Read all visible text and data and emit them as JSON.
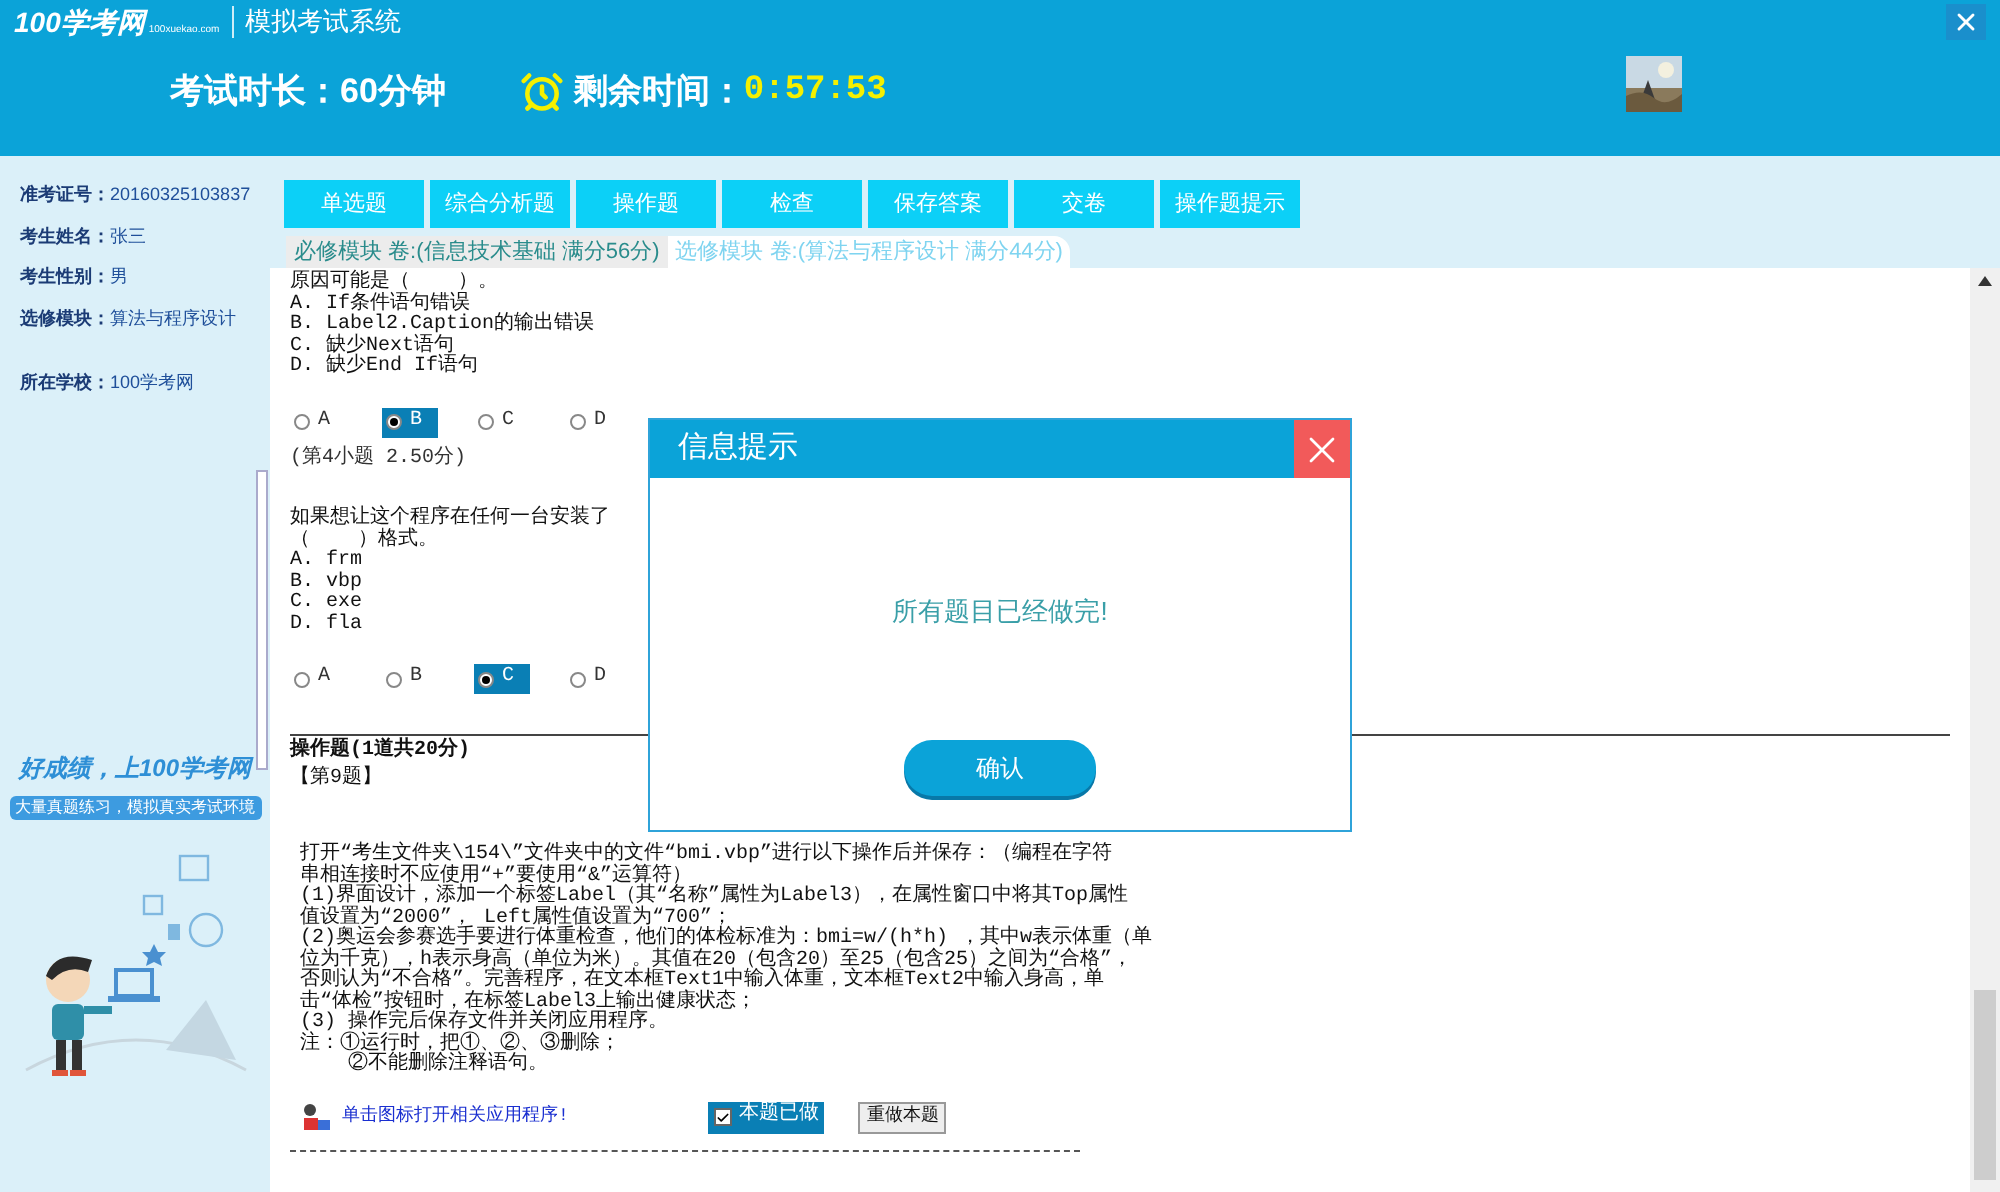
{
  "header": {
    "logo": "100学考网",
    "logo_url": "100xuekao.com",
    "app_title": "模拟考试系统",
    "duration": "考试时长：60分钟",
    "remaining_label": "剩余时间：",
    "remaining": "0:57:53"
  },
  "candidate": [
    {
      "label": "准考证号：",
      "value": "20160325103837"
    },
    {
      "label": "考生姓名：",
      "value": "张三"
    },
    {
      "label": "考生性别：",
      "value": "男"
    },
    {
      "label": "选修模块：",
      "value": "算法与程序设计"
    },
    {
      "label": "所在学校：",
      "value": "100学考网"
    }
  ],
  "promo": {
    "slogan": "好成绩，上100学考网",
    "tagline": "大量真题练习，模拟真实考试环境"
  },
  "toolbar": [
    "单选题",
    "综合分析题",
    "操作题",
    "检查",
    "保存答案",
    "交卷",
    "操作题提示"
  ],
  "tabs": [
    {
      "label": "必修模块 卷:(信息技术基础 满分56分)",
      "selected": true
    },
    {
      "label": "选修模块 卷:(算法与程序设计 满分44分)",
      "selected": false
    }
  ],
  "questions": [
    {
      "lines": [
        "原因可能是（    ）。",
        "A. If条件语句错误",
        "B. Label2.Caption的输出错误",
        "C. 缺少Next语句",
        "D. 缺少End If语句"
      ],
      "options": [
        {
          "label": "A",
          "selected": false
        },
        {
          "label": "B",
          "selected": true
        },
        {
          "label": "C",
          "selected": false
        },
        {
          "label": "D",
          "selected": false
        }
      ],
      "score": "(第4小题  2.50分)"
    },
    {
      "lines": [
        "如果想让这个程序在任何一台安装了",
        "（    ）格式。",
        "A. frm",
        "B. vbp",
        "C. exe",
        "D. fla"
      ],
      "options": [
        {
          "label": "A",
          "selected": false
        },
        {
          "label": "B",
          "selected": false
        },
        {
          "label": "C",
          "selected": true
        },
        {
          "label": "D",
          "selected": false
        }
      ]
    }
  ],
  "operation": {
    "heading": "操作题(1道共20分)",
    "number": "【第9题】",
    "lines": [
      "打开“考生文件夹\\154\\”文件夹中的文件“bmi.vbp”进行以下操作后并保存：（编程在字符",
      "串相连接时不应使用“+”要使用“&”运算符）",
      "(1)界面设计，添加一个标签Label（其“名称”属性为Label3），在属性窗口中将其Top属性",
      "值设置为“2000”， Left属性值设置为“700”；",
      "(2)奥运会参赛选手要进行体重检查，他们的体检标准为：bmi=w/(h*h) ，其中w表示体重（单",
      "位为千克），h表示身高（单位为米）。其值在20（包含20）至25（包含25）之间为“合格”，",
      "否则认为“不合格”。完善程序，在文本框Text1中输入体重，文本框Text2中输入身高，单",
      "击“体检”按钮时，在标签Label3上输出健康状态；",
      "(3) 操作完后保存文件并关闭应用程序。",
      "注：①运行时，把①、②、③删除；",
      "    ②不能删除注释语句。"
    ],
    "launch_text": "单击图标打开相关应用程序!",
    "done": {
      "label": "本题已做",
      "checked": true
    },
    "redo": "重做本题"
  },
  "dialog": {
    "title": "信息提示",
    "message": "所有题目已经做完!",
    "confirm": "确认"
  }
}
